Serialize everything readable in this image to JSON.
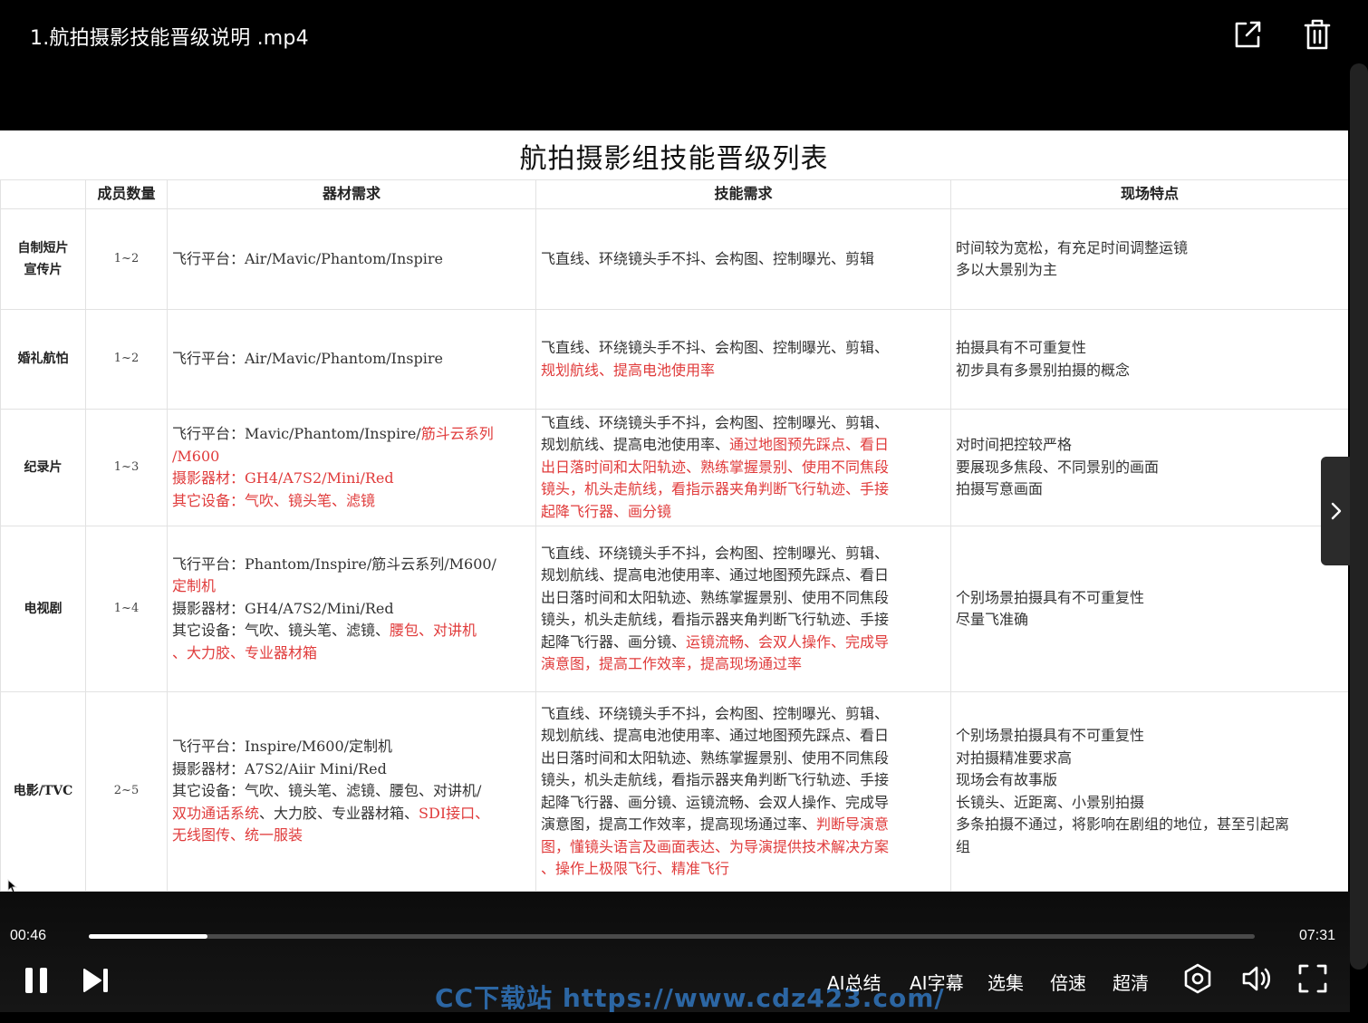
{
  "video": {
    "title": "1.航拍摄影技能晋级说明 .mp4",
    "current_time": "00:46",
    "duration": "07:31",
    "progress": 0.102
  },
  "slide": {
    "title": "航拍摄影组技能晋级列表",
    "headers": [
      "",
      "成员数量",
      "器材需求",
      "技能需求",
      "现场特点"
    ],
    "rows": [
      {
        "category": "自制短片\n宣传片",
        "count": "1~2",
        "equipment": [
          [
            {
              "t": "飞行平台：Air/Mavic/Phantom/Inspire",
              "r": false
            }
          ]
        ],
        "skills": [
          [
            {
              "t": "飞直线、环绕镜头手不抖、会构图、控制曝光、剪辑",
              "r": false
            }
          ]
        ],
        "features": [
          [
            {
              "t": "时间较为宽松，有充足时间调整运镜",
              "r": false
            }
          ],
          [
            {
              "t": "多以大景别为主",
              "r": false
            }
          ]
        ]
      },
      {
        "category": "婚礼航怕",
        "count": "1~2",
        "equipment": [
          [
            {
              "t": "飞行平台：Air/Mavic/Phantom/Inspire",
              "r": false
            }
          ]
        ],
        "skills": [
          [
            {
              "t": "飞直线、环绕镜头手不抖、会构图、控制曝光、剪辑、",
              "r": false
            }
          ],
          [
            {
              "t": "规划航线、提高电池使用率",
              "r": true
            }
          ]
        ],
        "features": [
          [
            {
              "t": "拍摄具有不可重复性",
              "r": false
            }
          ],
          [
            {
              "t": "初步具有多景别拍摄的概念",
              "r": false
            }
          ]
        ]
      },
      {
        "category": "纪录片",
        "count": "1~3",
        "equipment": [
          [
            {
              "t": "飞行平台：Mavic/Phantom/Inspire/",
              "r": false
            },
            {
              "t": "筋斗云系列",
              "r": true
            }
          ],
          [
            {
              "t": "/M600",
              "r": true
            }
          ],
          [
            {
              "t": "摄影器材：GH4/A7S2/Mini/Red",
              "r": true
            }
          ],
          [
            {
              "t": "其它设备：气吹、镜头笔、滤镜",
              "r": true
            }
          ]
        ],
        "skills": [
          [
            {
              "t": "飞直线、环绕镜头手不抖，会构图、控制曝光、剪辑、",
              "r": false
            }
          ],
          [
            {
              "t": "规划航线、提高电池使用率、",
              "r": false
            },
            {
              "t": "通过地图预先踩点、看日",
              "r": true
            }
          ],
          [
            {
              "t": "出日落时间和太阳轨迹、熟练掌握景别、使用不同焦段",
              "r": true
            }
          ],
          [
            {
              "t": "镜头，机头走航线，看指示器夹角判断飞行轨迹、手接",
              "r": true
            }
          ],
          [
            {
              "t": "起降飞行器、画分镜",
              "r": true
            }
          ]
        ],
        "features": [
          [
            {
              "t": "对时间把控较严格",
              "r": false
            }
          ],
          [
            {
              "t": "要展现多焦段、不同景别的画面",
              "r": false
            }
          ],
          [
            {
              "t": "拍摄写意画面",
              "r": false
            }
          ]
        ]
      },
      {
        "category": "电视剧",
        "count": "1~4",
        "equipment": [
          [
            {
              "t": "飞行平台：Phantom/Inspire/筋斗云系列/M600/",
              "r": false
            }
          ],
          [
            {
              "t": "定制机",
              "r": true
            }
          ],
          [
            {
              "t": "摄影器材：GH4/A7S2/Mini/Red",
              "r": false
            }
          ],
          [
            {
              "t": "其它设备：气吹、镜头笔、滤镜、",
              "r": false
            },
            {
              "t": "腰包、对讲机",
              "r": true
            }
          ],
          [
            {
              "t": "、大力胶、专业器材箱",
              "r": true
            }
          ]
        ],
        "skills": [
          [
            {
              "t": "飞直线、环绕镜头手不抖，会构图、控制曝光、剪辑、",
              "r": false
            }
          ],
          [
            {
              "t": "规划航线、提高电池使用率、通过地图预先踩点、看日",
              "r": false
            }
          ],
          [
            {
              "t": "出日落时间和太阳轨迹、熟练掌握景别、使用不同焦段",
              "r": false
            }
          ],
          [
            {
              "t": "镜头，机头走航线，看指示器夹角判断飞行轨迹、手接",
              "r": false
            }
          ],
          [
            {
              "t": "起降飞行器、画分镜、",
              "r": false
            },
            {
              "t": "运镜流畅、会双人操作、完成导",
              "r": true
            }
          ],
          [
            {
              "t": "演意图，提高工作效率，提高现场通过率",
              "r": true
            }
          ]
        ],
        "features": [
          [
            {
              "t": "个别场景拍摄具有不可重复性",
              "r": false
            }
          ],
          [
            {
              "t": "尽量飞准确",
              "r": false
            }
          ]
        ]
      },
      {
        "category": "电影/TVC",
        "count": "2~5",
        "equipment": [
          [
            {
              "t": "飞行平台：Inspire/M600/定制机",
              "r": false
            }
          ],
          [
            {
              "t": "摄影器材：A7S2/Aiir Mini/Red",
              "r": false
            }
          ],
          [
            {
              "t": "其它设备：气吹、镜头笔、滤镜、腰包、对讲机/",
              "r": false
            }
          ],
          [
            {
              "t": "双功通话系统",
              "r": true
            },
            {
              "t": "、大力胶、专业器材箱、",
              "r": false
            },
            {
              "t": "SDI接口、",
              "r": true
            }
          ],
          [
            {
              "t": "无线图传、统一服装",
              "r": true
            }
          ]
        ],
        "skills": [
          [
            {
              "t": "飞直线、环绕镜头手不抖，会构图、控制曝光、剪辑、",
              "r": false
            }
          ],
          [
            {
              "t": "规划航线、提高电池使用率、通过地图预先踩点、看日",
              "r": false
            }
          ],
          [
            {
              "t": "出日落时间和太阳轨迹、熟练掌握景别、使用不同焦段",
              "r": false
            }
          ],
          [
            {
              "t": "镜头，机头走航线，看指示器夹角判断飞行轨迹、手接",
              "r": false
            }
          ],
          [
            {
              "t": "起降飞行器、画分镜、运镜流畅、会双人操作、完成导",
              "r": false
            }
          ],
          [
            {
              "t": "演意图，提高工作效率，提高现场通过率、",
              "r": false
            },
            {
              "t": "判断导演意",
              "r": true
            }
          ],
          [
            {
              "t": "图，懂镜头语言及画面表达、为导演提供技术解决方案",
              "r": true
            }
          ],
          [
            {
              "t": "、操作上极限飞行、精准飞行",
              "r": true
            }
          ]
        ],
        "features": [
          [
            {
              "t": "个别场景拍摄具有不可重复性",
              "r": false
            }
          ],
          [
            {
              "t": "对拍摄精准要求高",
              "r": false
            }
          ],
          [
            {
              "t": "现场会有故事版",
              "r": false
            }
          ],
          [
            {
              "t": "长镜头、近距离、小景别拍摄",
              "r": false
            }
          ],
          [
            {
              "t": "多条拍摄不通过，将影响在剧组的地位，甚至引起离",
              "r": false
            }
          ],
          [
            {
              "t": "组",
              "r": false
            }
          ]
        ]
      }
    ]
  },
  "controls": {
    "menu": [
      "AI总结",
      "AI字幕",
      "选集",
      "倍速",
      "超清"
    ]
  },
  "watermark": "CC下载站 https://www.cdz423.com/",
  "colors": {
    "highlight_red": "#e03b3b",
    "watermark_blue": "#2f6fb3",
    "background": "#000000"
  },
  "icons": [
    "share-icon",
    "delete-icon",
    "next-panel-icon",
    "pause-icon",
    "next-icon",
    "settings-icon",
    "volume-icon",
    "fullscreen-icon"
  ]
}
